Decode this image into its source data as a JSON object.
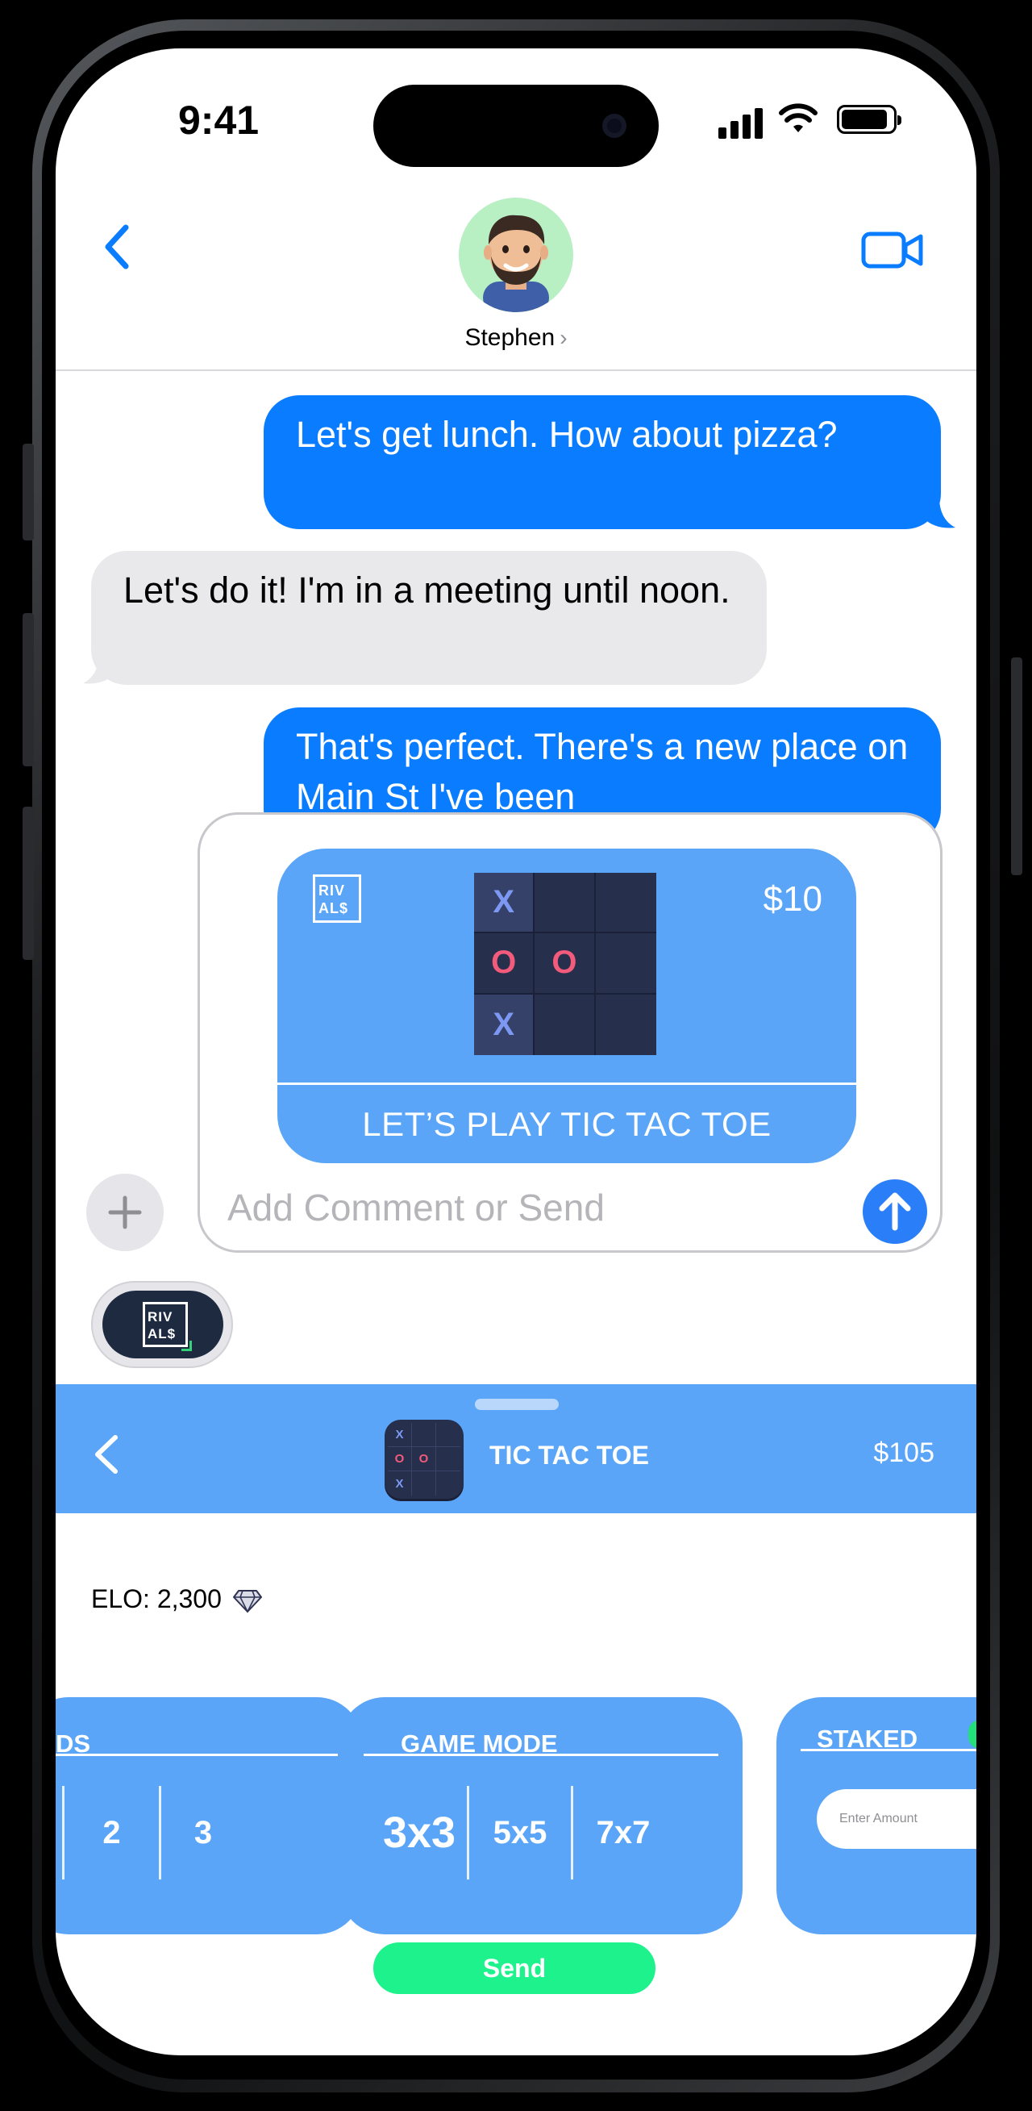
{
  "status_bar": {
    "time": "9:41"
  },
  "header": {
    "contact_name": "Stephen",
    "contact_chevron": "›"
  },
  "messages": [
    {
      "from": "me",
      "text": "Let's get lunch. How about pizza?"
    },
    {
      "from": "them",
      "text": "Let's do it! I'm in a meeting until noon."
    },
    {
      "from": "me",
      "text": "That's perfect. There's a new place on Main St I've been"
    }
  ],
  "game_card": {
    "logo_line1": "RIV",
    "logo_line2": "AL$",
    "price": "$10",
    "board": [
      "X",
      "",
      "",
      "O",
      "O",
      "",
      "X",
      "",
      ""
    ],
    "cta": "LET’S PLAY TIC TAC TOE"
  },
  "compose": {
    "placeholder": "Add Comment or Send"
  },
  "app_drawer": {
    "logo_line1": "RIV",
    "logo_line2": "AL$"
  },
  "panel": {
    "title": "TIC TAC TOE",
    "balance": "$105",
    "icon_board": [
      "X",
      "",
      "",
      "O",
      "O",
      "",
      "X",
      "",
      ""
    ],
    "elo_label": "ELO: 2,300",
    "rounds": {
      "title": "DS",
      "values": [
        "2",
        "3"
      ]
    },
    "game_mode": {
      "title": "GAME MODE",
      "options": [
        "3x3",
        "5x5",
        "7x7"
      ],
      "selected": "3x3"
    },
    "staked": {
      "title": "STAKED",
      "placeholder": "Enter Amount"
    },
    "send_label": "Send"
  },
  "colors": {
    "imessage_blue": "#0a7cff",
    "received_gray": "#e9e9eb",
    "rivals_blue": "#5aa5f8",
    "board_navy": "#262f4b",
    "x_color": "#7c98f2",
    "o_color": "#f25b7c",
    "send_green": "#1ef28c"
  }
}
